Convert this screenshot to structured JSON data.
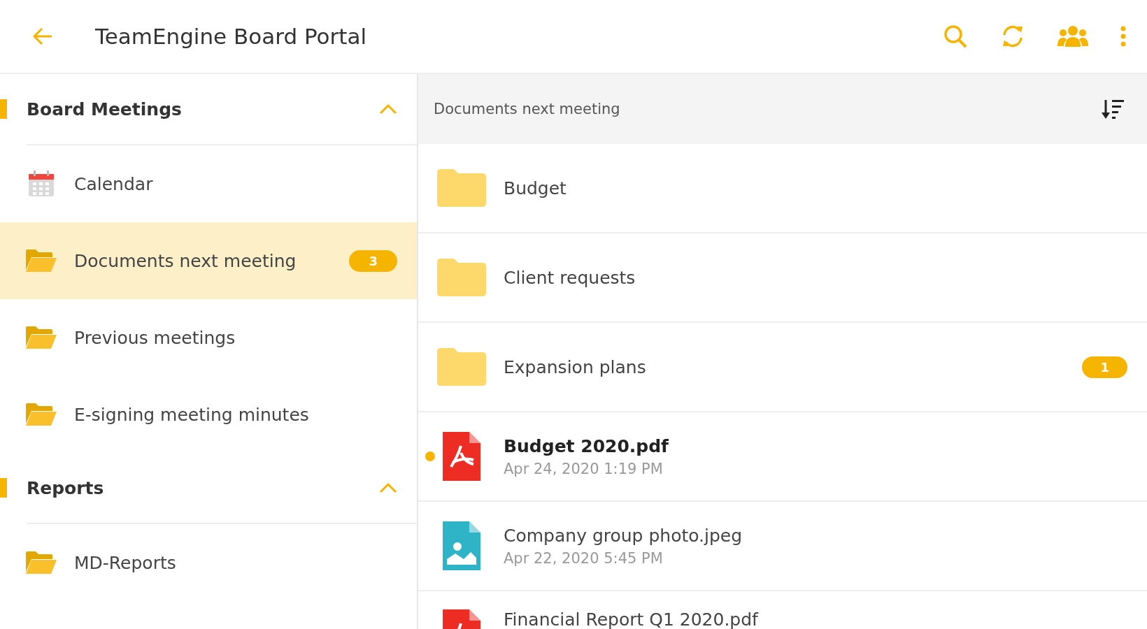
{
  "app_bar": {
    "title": "TeamEngine Board Portal"
  },
  "sidebar": {
    "sections": [
      {
        "title": "Board Meetings",
        "expanded": true,
        "items": [
          {
            "kind": "calendar",
            "label": "Calendar",
            "selected": false
          },
          {
            "kind": "folder",
            "label": "Documents next meeting",
            "selected": true,
            "badge": "3"
          },
          {
            "kind": "folder",
            "label": "Previous meetings",
            "selected": false
          },
          {
            "kind": "folder",
            "label": "E-signing meeting minutes",
            "selected": false
          }
        ]
      },
      {
        "title": "Reports",
        "expanded": true,
        "items": [
          {
            "kind": "folder",
            "label": "MD-Reports",
            "selected": false
          }
        ]
      }
    ]
  },
  "content": {
    "title": "Documents next meeting",
    "rows": [
      {
        "kind": "folder",
        "name": "Budget"
      },
      {
        "kind": "folder",
        "name": "Client requests"
      },
      {
        "kind": "folder",
        "name": "Expansion plans",
        "badge": "1"
      },
      {
        "kind": "pdf",
        "name": "Budget 2020.pdf",
        "date": "Apr 24, 2020 1:19 PM",
        "unread": true
      },
      {
        "kind": "image",
        "name": "Company group photo.jpeg",
        "date": "Apr 22, 2020 5:45 PM",
        "unread": false
      },
      {
        "kind": "pdf",
        "name": "Financial Report Q1 2020.pdf",
        "unread": false
      }
    ]
  }
}
